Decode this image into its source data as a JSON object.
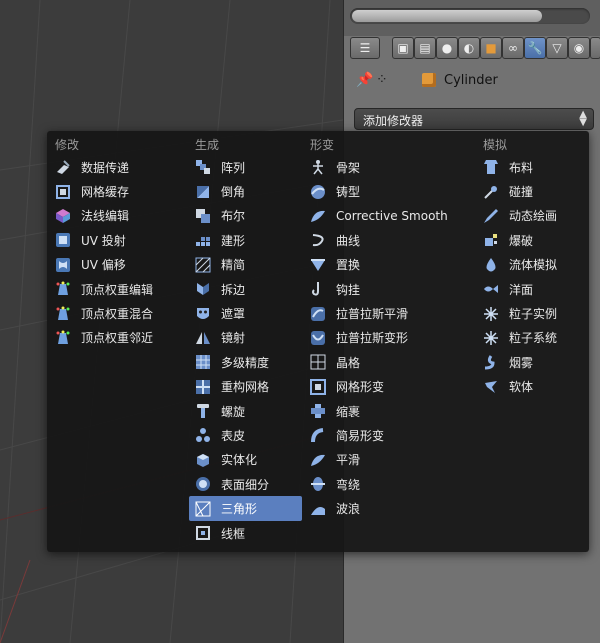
{
  "properties": {
    "object_name": "Cylinder",
    "add_modifier_label": "添加修改器"
  },
  "menu": {
    "columns": [
      {
        "header": "修改",
        "items": [
          {
            "label": "数据传递",
            "icon": "data-transfer-icon"
          },
          {
            "label": "网格缓存",
            "icon": "mesh-cache-icon"
          },
          {
            "label": "法线编辑",
            "icon": "normal-edit-icon"
          },
          {
            "label": "UV 投射",
            "icon": "uv-project-icon"
          },
          {
            "label": "UV 偏移",
            "icon": "uv-warp-icon"
          },
          {
            "label": "顶点权重编辑",
            "icon": "vertex-weight-edit-icon"
          },
          {
            "label": "顶点权重混合",
            "icon": "vertex-weight-mix-icon"
          },
          {
            "label": "顶点权重邻近",
            "icon": "vertex-weight-proximity-icon"
          }
        ]
      },
      {
        "header": "生成",
        "items": [
          {
            "label": "阵列",
            "icon": "array-icon"
          },
          {
            "label": "倒角",
            "icon": "bevel-icon"
          },
          {
            "label": "布尔",
            "icon": "boolean-icon"
          },
          {
            "label": "建形",
            "icon": "build-icon"
          },
          {
            "label": "精简",
            "icon": "decimate-icon"
          },
          {
            "label": "拆边",
            "icon": "edge-split-icon"
          },
          {
            "label": "遮罩",
            "icon": "mask-icon"
          },
          {
            "label": "镜射",
            "icon": "mirror-icon"
          },
          {
            "label": "多级精度",
            "icon": "multires-icon"
          },
          {
            "label": "重构网格",
            "icon": "remesh-icon"
          },
          {
            "label": "螺旋",
            "icon": "screw-icon"
          },
          {
            "label": "表皮",
            "icon": "skin-icon"
          },
          {
            "label": "实体化",
            "icon": "solidify-icon"
          },
          {
            "label": "表面细分",
            "icon": "subsurf-icon"
          },
          {
            "label": "三角形",
            "icon": "triangulate-icon"
          },
          {
            "label": "线框",
            "icon": "wireframe-icon"
          }
        ]
      },
      {
        "header": "形变",
        "items": [
          {
            "label": "骨架",
            "icon": "armature-icon"
          },
          {
            "label": "铸型",
            "icon": "cast-icon"
          },
          {
            "label": "Corrective Smooth",
            "icon": "corrective-smooth-icon"
          },
          {
            "label": "曲线",
            "icon": "curve-icon"
          },
          {
            "label": "置换",
            "icon": "displace-icon"
          },
          {
            "label": "钩挂",
            "icon": "hook-icon"
          },
          {
            "label": "拉普拉斯平滑",
            "icon": "laplacian-smooth-icon"
          },
          {
            "label": "拉普拉斯变形",
            "icon": "laplacian-deform-icon"
          },
          {
            "label": "晶格",
            "icon": "lattice-icon"
          },
          {
            "label": "网格形变",
            "icon": "mesh-deform-icon"
          },
          {
            "label": "缩裹",
            "icon": "shrinkwrap-icon"
          },
          {
            "label": "简易形变",
            "icon": "simple-deform-icon"
          },
          {
            "label": "平滑",
            "icon": "smooth-icon"
          },
          {
            "label": "弯绕",
            "icon": "warp-icon"
          },
          {
            "label": "波浪",
            "icon": "wave-icon"
          }
        ]
      },
      {
        "header": "模拟",
        "items": [
          {
            "label": "布料",
            "icon": "cloth-icon"
          },
          {
            "label": "碰撞",
            "icon": "collision-icon"
          },
          {
            "label": "动态绘画",
            "icon": "dynamic-paint-icon"
          },
          {
            "label": "爆破",
            "icon": "explode-icon"
          },
          {
            "label": "流体模拟",
            "icon": "fluid-icon"
          },
          {
            "label": "洋面",
            "icon": "ocean-icon"
          },
          {
            "label": "粒子实例",
            "icon": "particle-instance-icon"
          },
          {
            "label": "粒子系统",
            "icon": "particle-system-icon"
          },
          {
            "label": "烟雾",
            "icon": "smoke-icon"
          },
          {
            "label": "软体",
            "icon": "soft-body-icon"
          }
        ]
      }
    ],
    "selected": "三角形"
  },
  "colors": {
    "menu_bg": "#161616",
    "selected_bg": "#5b7fbf",
    "header_text": "#9a9a9a",
    "icon_blue": "#8fb3e8"
  }
}
